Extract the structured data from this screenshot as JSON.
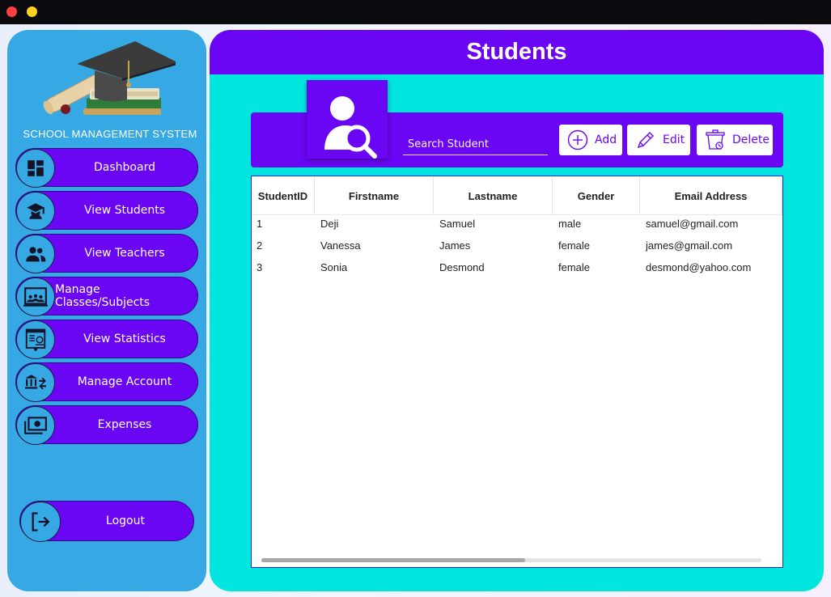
{
  "window": {
    "controls": [
      "close",
      "minimize"
    ]
  },
  "sidebar": {
    "brand": "SCHOOL MANAGEMENT SYSTEM",
    "items": [
      {
        "label": "Dashboard",
        "icon": "dashboard-icon"
      },
      {
        "label": "View Students",
        "icon": "graduate-icon"
      },
      {
        "label": "View Teachers",
        "icon": "people-icon"
      },
      {
        "label": "Manage Classes/Subjects",
        "icon": "classroom-icon"
      },
      {
        "label": "View Statistics",
        "icon": "report-icon"
      },
      {
        "label": "Manage Account",
        "icon": "bank-transfer-icon"
      },
      {
        "label": "Expenses",
        "icon": "money-icon"
      }
    ],
    "logout": {
      "label": "Logout",
      "icon": "logout-icon"
    }
  },
  "main": {
    "title": "Students",
    "search": {
      "placeholder": "Search Student",
      "value": ""
    },
    "buttons": {
      "add": "Add",
      "edit": "Edit",
      "delete": "Delete"
    },
    "table": {
      "columns": [
        "StudentID",
        "Firstname",
        "Lastname",
        "Gender",
        "Email Address"
      ],
      "rows": [
        [
          "1",
          "Deji",
          "Samuel",
          "male",
          "samuel@gmail.com"
        ],
        [
          "2",
          "Vanessa",
          "James",
          "female",
          "james@gmail.com"
        ],
        [
          "3",
          "Sonia",
          "Desmond",
          "female",
          "desmond@yahoo.com"
        ]
      ]
    }
  },
  "colors": {
    "accent": "#6a06f3",
    "sidebar": "#36a9e5",
    "content": "#00e6de"
  }
}
